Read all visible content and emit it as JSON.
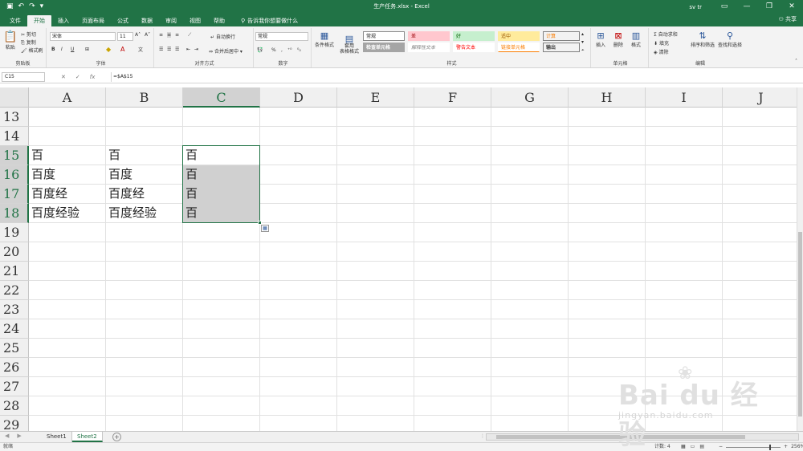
{
  "window": {
    "title": "生产任务.xlsx - Excel",
    "user": "sv tr",
    "share": "共享"
  },
  "tabs": [
    "文件",
    "开始",
    "插入",
    "页面布局",
    "公式",
    "数据",
    "审阅",
    "视图",
    "帮助"
  ],
  "active_tab": 1,
  "tell_me": "告诉我你想要做什么",
  "ribbon": {
    "clipboard": {
      "paste": "粘贴",
      "cut": "剪切",
      "copy": "复制",
      "format_painter": "格式刷",
      "label": "剪贴板"
    },
    "font": {
      "name": "宋体",
      "size": "11",
      "label": "字体",
      "bold": "B",
      "italic": "I",
      "underline": "U"
    },
    "alignment": {
      "wrap": "自动换行",
      "merge": "合并后居中",
      "label": "对齐方式"
    },
    "number": {
      "format": "常规",
      "label": "数字"
    },
    "styles": {
      "conditional": "条件格式",
      "table": "套用\n表格格式",
      "cells": [
        {
          "text": "常规",
          "bg": "#ffffff",
          "color": "#222222"
        },
        {
          "text": "差",
          "bg": "#ffc7ce",
          "color": "#9c0006"
        },
        {
          "text": "好",
          "bg": "#c6efce",
          "color": "#006100"
        },
        {
          "text": "适中",
          "bg": "#ffeb9c",
          "color": "#9c5700"
        },
        {
          "text": "计算",
          "bg": "#f2f2f2",
          "color": "#fa7d00"
        },
        {
          "text": "检查单元格",
          "bg": "#a5a5a5",
          "color": "#ffffff"
        },
        {
          "text": "解释性文本",
          "bg": "#ffffff",
          "color": "#7f7f7f"
        },
        {
          "text": "警告文本",
          "bg": "#ffffff",
          "color": "#ff0000"
        },
        {
          "text": "链接单元格",
          "bg": "#ffffff",
          "color": "#fa7d00"
        },
        {
          "text": "输出",
          "bg": "#f2f2f2",
          "color": "#3f3f3f"
        }
      ],
      "label": "样式"
    },
    "cells_group": {
      "insert": "插入",
      "delete": "删除",
      "format": "格式",
      "label": "单元格"
    },
    "editing": {
      "autosum": "自动求和",
      "fill": "填充",
      "clear": "清除",
      "sort": "排序和筛选",
      "find": "查找和选择",
      "label": "编辑"
    }
  },
  "formula_bar": {
    "name_box": "C15",
    "formula": "=$A$15"
  },
  "sheet": {
    "columns": [
      "A",
      "B",
      "C",
      "D",
      "E",
      "F",
      "G",
      "H",
      "I",
      "J"
    ],
    "selected_column": "C",
    "rows": [
      "13",
      "14",
      "15",
      "16",
      "17",
      "18",
      "19",
      "20",
      "21",
      "22",
      "23",
      "24",
      "25",
      "26",
      "27",
      "28",
      "29"
    ],
    "selected_rows": [
      "15",
      "16",
      "17",
      "18"
    ],
    "cells": {
      "A15": "百",
      "B15": "百",
      "C15": "百",
      "A16": "百度",
      "B16": "百度",
      "C16": "百",
      "A17": "百度经",
      "B17": "百度经",
      "C17": "百",
      "A18": "百度经验",
      "B18": "百度经验",
      "C18": "百"
    }
  },
  "sheet_tabs": [
    "Sheet1",
    "Sheet2"
  ],
  "active_sheet": "Sheet2",
  "status": {
    "ready": "就绪",
    "count": "计数: 4",
    "zoom": "256%"
  },
  "watermark": {
    "main": "Bai du 经验",
    "url": "jingyan.baidu.com"
  }
}
